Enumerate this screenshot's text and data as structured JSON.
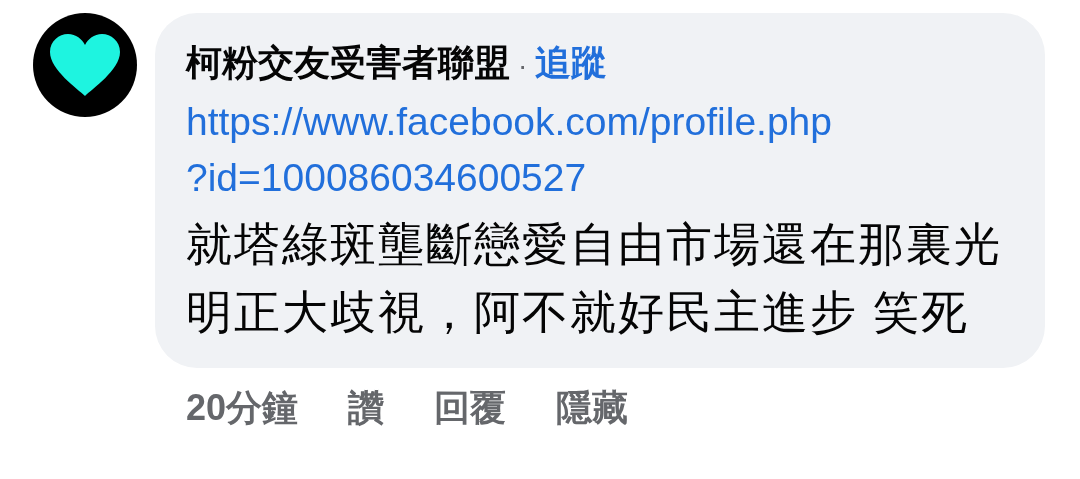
{
  "comment": {
    "author": "柯粉交友受害者聯盟",
    "separator": "·",
    "follow": "追蹤",
    "link_lines": [
      "https://www.facebook.com/profile.php",
      "?id=100086034600527"
    ],
    "text": "就塔綠斑壟斷戀愛自由市場還在那裏光明正大歧視，阿不就好民主進步 笑死",
    "time": "20分鐘",
    "actions": [
      {
        "label": "讚"
      },
      {
        "label": "回覆"
      },
      {
        "label": "隱藏"
      }
    ]
  }
}
